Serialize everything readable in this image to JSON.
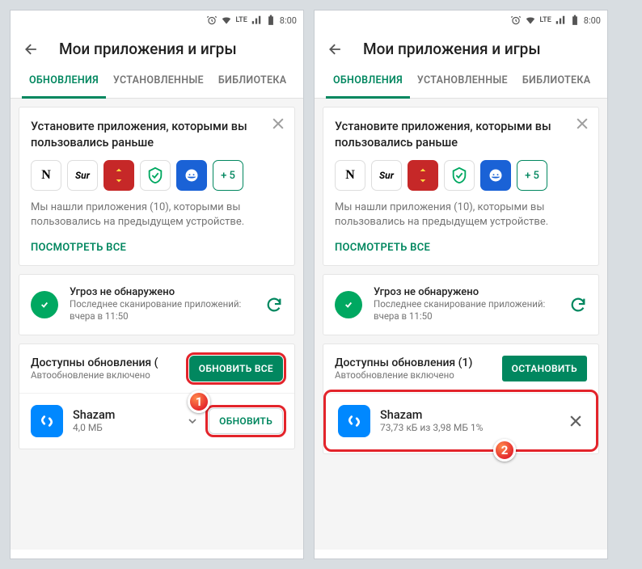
{
  "status": {
    "time": "8:00",
    "network": "LTE"
  },
  "header": {
    "title": "Мои приложения и игры"
  },
  "tabs": {
    "updates": "ОБНОВЛЕНИЯ",
    "installed": "УСТАНОВЛЕННЫЕ",
    "library": "БИБЛИОТЕКА"
  },
  "suggestions": {
    "title": "Установите приложения, которыми вы пользовались раньше",
    "plus_label": "+ 5",
    "found_text": "Мы нашли приложения (10), которыми вы пользовались на предыдущем устройстве.",
    "view_all": "ПОСМОТРЕТЬ ВСЕ"
  },
  "protect": {
    "title": "Угроз не обнаружено",
    "subtitle": "Последнее сканирование приложений: вчера в 11:50"
  },
  "left": {
    "updates_title": "Доступны обновления (",
    "updates_sub": "Автообновление включено",
    "update_all": "ОБНОВИТЬ ВСЕ",
    "app_name": "Shazam",
    "app_size": "4,0 МБ",
    "update_btn": "ОБНОВИТЬ"
  },
  "right": {
    "updates_title": "Доступны обновления (1)",
    "updates_sub": "Автообновление включено",
    "stop_btn": "ОСТАНОВИТЬ",
    "app_name": "Shazam",
    "progress": "73,73 кБ из 3,98 МБ  1%"
  },
  "callouts": {
    "one": "1",
    "two": "2"
  }
}
